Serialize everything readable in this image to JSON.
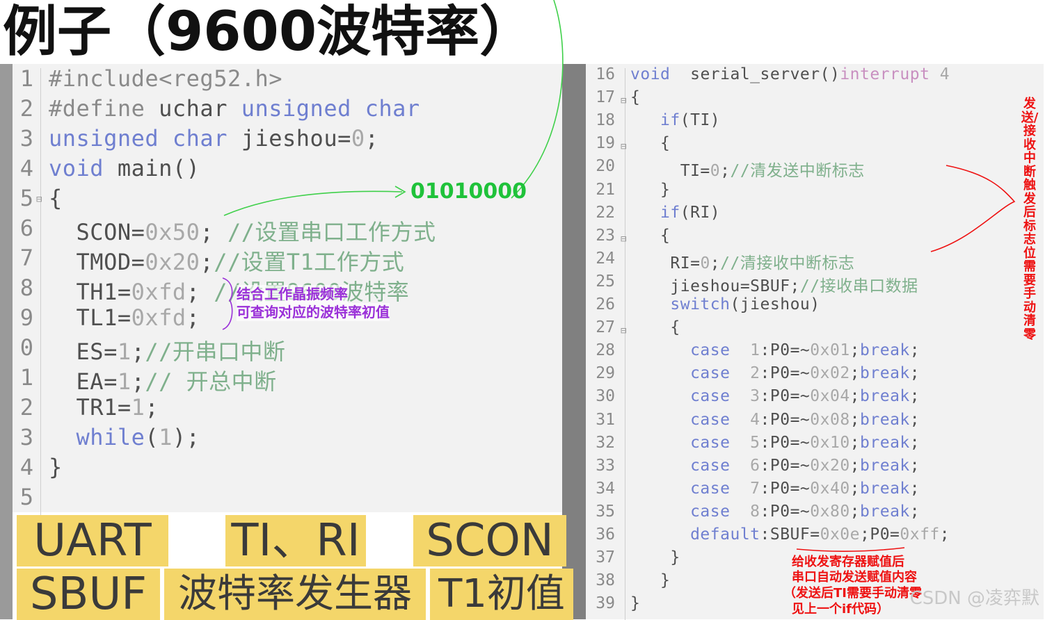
{
  "title": "例子（9600波特率）",
  "left_code": [
    {
      "n": "1",
      "p": [
        [
          "pp",
          "#include<reg52.h>"
        ]
      ]
    },
    {
      "n": "2",
      "p": [
        [
          "pp",
          "#define "
        ],
        [
          "",
          "uchar "
        ],
        [
          "kw",
          "unsigned char"
        ]
      ]
    },
    {
      "n": "3",
      "p": [
        [
          "kw",
          "unsigned char "
        ],
        [
          "",
          "jieshou="
        ],
        [
          "num",
          "0"
        ],
        [
          "",
          ";"
        ]
      ]
    },
    {
      "n": "4",
      "p": [
        [
          "kw",
          "void "
        ],
        [
          "",
          "main()"
        ]
      ]
    },
    {
      "n": "5",
      "p": [
        [
          "",
          "{"
        ]
      ]
    },
    {
      "n": "6",
      "p": [
        [
          "",
          "  SCON="
        ],
        [
          "num",
          "0x50"
        ],
        [
          "",
          "; "
        ],
        [
          "cm",
          "//设置串口工作方式"
        ]
      ]
    },
    {
      "n": "7",
      "p": [
        [
          "",
          "  TMOD="
        ],
        [
          "num",
          "0x20"
        ],
        [
          "",
          ";"
        ],
        [
          "cm",
          "//设置T1工作方式"
        ]
      ]
    },
    {
      "n": "8",
      "p": [
        [
          "",
          "  TH1="
        ],
        [
          "num",
          "0xfd"
        ],
        [
          "",
          "; "
        ],
        [
          "cm",
          "//设置9600波特率"
        ]
      ]
    },
    {
      "n": "9",
      "p": [
        [
          "",
          "  TL1="
        ],
        [
          "num",
          "0xfd"
        ],
        [
          "",
          ";"
        ]
      ]
    },
    {
      "n": "0",
      "p": [
        [
          "",
          "  ES="
        ],
        [
          "num",
          "1"
        ],
        [
          "",
          ";"
        ],
        [
          "cm",
          "//开串口中断"
        ]
      ]
    },
    {
      "n": "1",
      "p": [
        [
          "",
          "  EA="
        ],
        [
          "num",
          "1"
        ],
        [
          "",
          ";"
        ],
        [
          "cm",
          "// 开总中断"
        ]
      ]
    },
    {
      "n": "2",
      "p": [
        [
          "",
          "  TR1="
        ],
        [
          "num",
          "1"
        ],
        [
          "",
          ";"
        ]
      ]
    },
    {
      "n": "3",
      "p": [
        [
          "kw",
          "  while"
        ],
        [
          "",
          "("
        ],
        [
          "num",
          "1"
        ],
        [
          "",
          ");"
        ]
      ]
    },
    {
      "n": "4",
      "p": [
        [
          "",
          "}"
        ]
      ]
    },
    {
      "n": "5",
      "p": [
        [
          "",
          ""
        ]
      ]
    }
  ],
  "right_code": [
    {
      "n": "16",
      "p": [
        [
          "kw",
          "void  "
        ],
        [
          "",
          "serial_server()"
        ],
        [
          "rd",
          "interrupt "
        ],
        [
          "num",
          "4"
        ]
      ]
    },
    {
      "n": "17",
      "p": [
        [
          "",
          "{"
        ]
      ]
    },
    {
      "n": "18",
      "p": [
        [
          "kw",
          "   if"
        ],
        [
          "",
          "(TI)"
        ]
      ]
    },
    {
      "n": "19",
      "p": [
        [
          "",
          "   {"
        ]
      ]
    },
    {
      "n": "20",
      "p": [
        [
          "",
          "     TI="
        ],
        [
          "num",
          "0"
        ],
        [
          "",
          ";"
        ],
        [
          "cm",
          "//清发送中断标志"
        ]
      ]
    },
    {
      "n": "21",
      "p": [
        [
          "",
          "   }"
        ]
      ]
    },
    {
      "n": "22",
      "p": [
        [
          "kw",
          "   if"
        ],
        [
          "",
          "(RI)"
        ]
      ]
    },
    {
      "n": "23",
      "p": [
        [
          "",
          "   {"
        ]
      ]
    },
    {
      "n": "24",
      "p": [
        [
          "",
          "    RI="
        ],
        [
          "num",
          "0"
        ],
        [
          "",
          ";"
        ],
        [
          "cm",
          "//清接收中断标志"
        ]
      ]
    },
    {
      "n": "25",
      "p": [
        [
          "",
          "    jieshou=SBUF;"
        ],
        [
          "cm",
          "//接收串口数据"
        ]
      ]
    },
    {
      "n": "26",
      "p": [
        [
          "kw",
          "    switch"
        ],
        [
          "",
          "(jieshou)"
        ]
      ]
    },
    {
      "n": "27",
      "p": [
        [
          "",
          "    {"
        ]
      ]
    },
    {
      "n": "28",
      "p": [
        [
          "kw",
          "      case  "
        ],
        [
          "num",
          "1"
        ],
        [
          "",
          ":P0=~"
        ],
        [
          "num",
          "0x01"
        ],
        [
          "",
          ";"
        ],
        [
          "kw",
          "break"
        ],
        [
          "",
          ";"
        ]
      ]
    },
    {
      "n": "29",
      "p": [
        [
          "kw",
          "      case  "
        ],
        [
          "num",
          "2"
        ],
        [
          "",
          ":P0=~"
        ],
        [
          "num",
          "0x02"
        ],
        [
          "",
          ";"
        ],
        [
          "kw",
          "break"
        ],
        [
          "",
          ";"
        ]
      ]
    },
    {
      "n": "30",
      "p": [
        [
          "kw",
          "      case  "
        ],
        [
          "num",
          "3"
        ],
        [
          "",
          ":P0=~"
        ],
        [
          "num",
          "0x04"
        ],
        [
          "",
          ";"
        ],
        [
          "kw",
          "break"
        ],
        [
          "",
          ";"
        ]
      ]
    },
    {
      "n": "31",
      "p": [
        [
          "kw",
          "      case  "
        ],
        [
          "num",
          "4"
        ],
        [
          "",
          ":P0=~"
        ],
        [
          "num",
          "0x08"
        ],
        [
          "",
          ";"
        ],
        [
          "kw",
          "break"
        ],
        [
          "",
          ";"
        ]
      ]
    },
    {
      "n": "32",
      "p": [
        [
          "kw",
          "      case  "
        ],
        [
          "num",
          "5"
        ],
        [
          "",
          ":P0=~"
        ],
        [
          "num",
          "0x10"
        ],
        [
          "",
          ";"
        ],
        [
          "kw",
          "break"
        ],
        [
          "",
          ";"
        ]
      ]
    },
    {
      "n": "33",
      "p": [
        [
          "kw",
          "      case  "
        ],
        [
          "num",
          "6"
        ],
        [
          "",
          ":P0=~"
        ],
        [
          "num",
          "0x20"
        ],
        [
          "",
          ";"
        ],
        [
          "kw",
          "break"
        ],
        [
          "",
          ";"
        ]
      ]
    },
    {
      "n": "34",
      "p": [
        [
          "kw",
          "      case  "
        ],
        [
          "num",
          "7"
        ],
        [
          "",
          ":P0=~"
        ],
        [
          "num",
          "0x40"
        ],
        [
          "",
          ";"
        ],
        [
          "kw",
          "break"
        ],
        [
          "",
          ";"
        ]
      ]
    },
    {
      "n": "35",
      "p": [
        [
          "kw",
          "      case  "
        ],
        [
          "num",
          "8"
        ],
        [
          "",
          ":P0=~"
        ],
        [
          "num",
          "0x80"
        ],
        [
          "",
          ";"
        ],
        [
          "kw",
          "break"
        ],
        [
          "",
          ";"
        ]
      ]
    },
    {
      "n": "36",
      "p": [
        [
          "kw",
          "      default"
        ],
        [
          "",
          ":SBUF="
        ],
        [
          "num",
          "0x0e"
        ],
        [
          "",
          ";P0="
        ],
        [
          "num",
          "0xff"
        ],
        [
          "",
          ";"
        ]
      ]
    },
    {
      "n": "37",
      "p": [
        [
          "",
          "    }"
        ]
      ]
    },
    {
      "n": "38",
      "p": [
        [
          "",
          "   }"
        ]
      ]
    },
    {
      "n": "39",
      "p": [
        [
          "",
          "}"
        ]
      ]
    }
  ],
  "tags": {
    "uart": "UART",
    "tiri": "TI、RI",
    "scon": "SCON",
    "sbuf": "SBUF",
    "baud": "波特率发生器",
    "t1": "T1初值"
  },
  "annotations": {
    "binary": "01010000",
    "crystal_1": "结合工作晶振频率",
    "crystal_2": "可查询对应的波特率初值",
    "flag_clear": "发送/接收中断触发后标志位需要手动清零",
    "sbuf_1": "给收发寄存器赋值后",
    "sbuf_2": "串口自动发送赋值内容",
    "sbuf_3": "（发送后TI需要手动清零",
    "sbuf_4": "见上一个if代码）"
  },
  "watermark": "CSDN @凌弈默",
  "colors": {
    "keyword": "#6f7fd0",
    "comment": "#7fb08c",
    "tag_bg": "#f4d66a",
    "green_ann": "#1fc23a",
    "purple_ann": "#9a30d8",
    "red_ann": "#ee1111"
  }
}
